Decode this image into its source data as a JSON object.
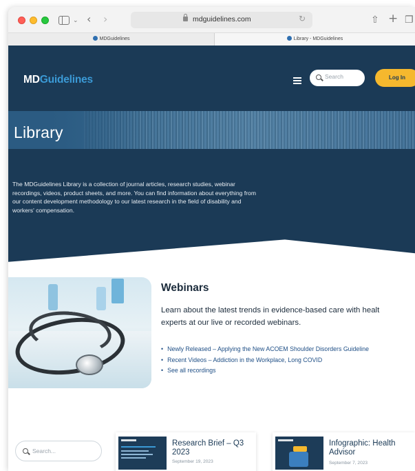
{
  "browser": {
    "url": "mdguidelines.com",
    "tabs": [
      {
        "label": "MDGuidelines"
      },
      {
        "label": "Library - MDGuidelines"
      }
    ]
  },
  "header": {
    "logo_md": "MD",
    "logo_guidelines": "Guidelines",
    "search_placeholder": "Search",
    "login_label": "Log In"
  },
  "hero": {
    "title": "Library",
    "intro": "The MDGuidelines Library is a collection of journal articles, research studies, webinar recordings, videos, product sheets, and more. You can find information about everything from our content development methodology to our latest research in the field of disability and workers' compensation."
  },
  "webinars": {
    "title": "Webinars",
    "description_line1": "Learn about the latest trends in evidence-based care with healt",
    "description_line2": "experts at our live or recorded webinars.",
    "links": [
      "Newly Released – Applying the New ACOEM Shoulder Disorders Guideline",
      "Recent Videos – Addiction in the Workplace, Long COVID",
      "See all recordings"
    ]
  },
  "library": {
    "search_placeholder": "Search...",
    "cards": [
      {
        "title_line1": "Research Brief – Q3",
        "title_line2": "2023",
        "date": "September 19, 2023"
      },
      {
        "title_line1": "Infographic: Health",
        "title_line2": "Advisor",
        "date": "September 7, 2023"
      }
    ]
  },
  "colors": {
    "navy": "#1b3a56",
    "brand_blue": "#3b9ad6",
    "login_yellow": "#f5b82e",
    "link_blue": "#1f4f86"
  },
  "icons": [
    "close-icon",
    "minimize-icon",
    "zoom-icon",
    "sidebar-icon",
    "chevron-down-icon",
    "back-icon",
    "forward-icon",
    "lock-icon",
    "reload-icon",
    "share-icon",
    "new-tab-icon",
    "tab-overview-icon",
    "menu-icon",
    "search-icon"
  ]
}
